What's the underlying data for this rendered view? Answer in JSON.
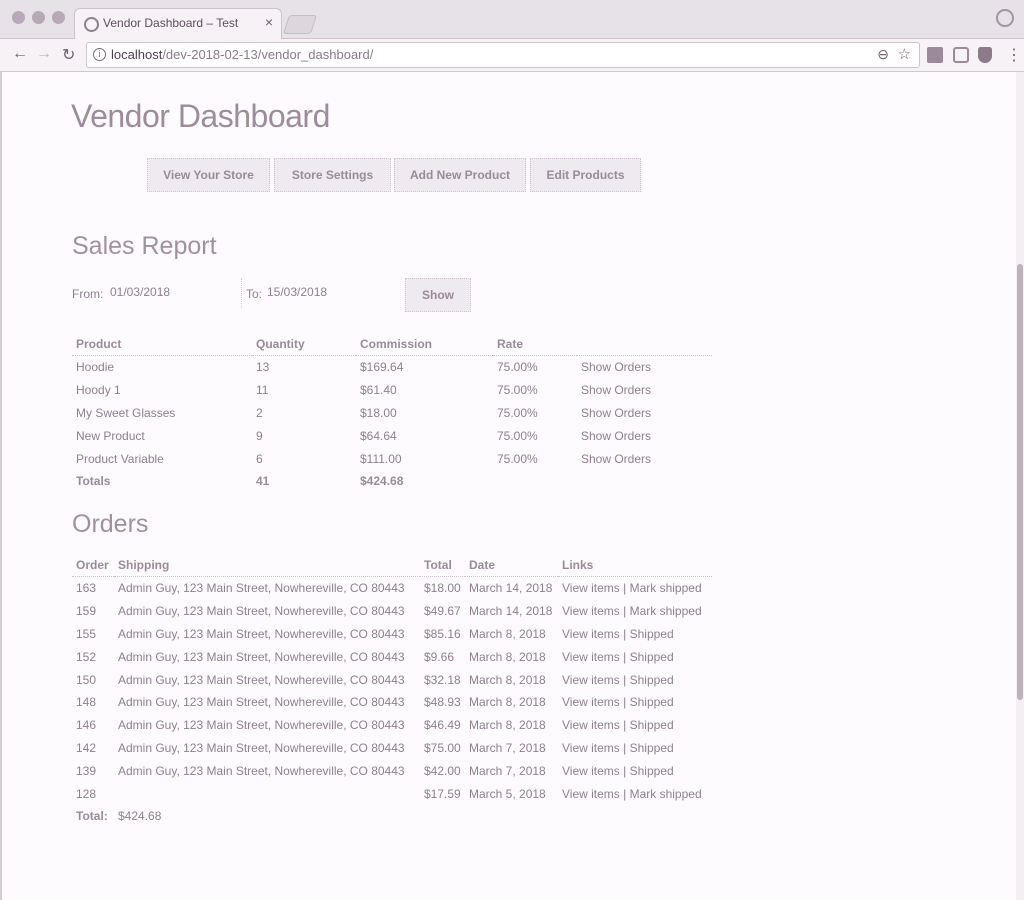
{
  "browser": {
    "tab_title": "Vendor Dashboard – Test",
    "tab_close": "×",
    "url_host": "localhost",
    "url_path": "/dev-2018-02-13/vendor_dashboard/",
    "back_glyph": "←",
    "forward_glyph": "→",
    "reload_glyph": "↻",
    "zoom_glyph": "⊖",
    "star_glyph": "☆",
    "menu_glyph": "⋮"
  },
  "page": {
    "title": "Vendor Dashboard",
    "nav_buttons": [
      "View Your Store",
      "Store Settings",
      "Add New Product",
      "Edit Products"
    ]
  },
  "sales_report": {
    "title": "Sales Report",
    "from_label": "From:",
    "from_value": "01/03/2018",
    "to_label": "To:",
    "to_value": "15/03/2018",
    "show_label": "Show",
    "headers": [
      "Product",
      "Quantity",
      "Commission",
      "Rate"
    ],
    "rows": [
      {
        "product": "Hoodie",
        "quantity": "13",
        "commission": "$169.64",
        "rate": "75.00%",
        "link": "Show Orders"
      },
      {
        "product": "Hoody 1",
        "quantity": "11",
        "commission": "$61.40",
        "rate": "75.00%",
        "link": "Show Orders"
      },
      {
        "product": "My Sweet Glasses",
        "quantity": "2",
        "commission": "$18.00",
        "rate": "75.00%",
        "link": "Show Orders"
      },
      {
        "product": "New Product",
        "quantity": "9",
        "commission": "$64.64",
        "rate": "75.00%",
        "link": "Show Orders"
      },
      {
        "product": "Product Variable",
        "quantity": "6",
        "commission": "$111.00",
        "rate": "75.00%",
        "link": "Show Orders"
      }
    ],
    "totals": {
      "label": "Totals",
      "quantity": "41",
      "commission": "$424.68"
    }
  },
  "orders": {
    "title": "Orders",
    "headers": [
      "Order",
      "Shipping",
      "Total",
      "Date",
      "Links"
    ],
    "rows": [
      {
        "order": "163",
        "shipping": "Admin Guy, 123 Main Street, Nowhereville, CO 80443",
        "total": "$18.00",
        "date": "March 14, 2018",
        "view": "View items",
        "status": "Mark shipped"
      },
      {
        "order": "159",
        "shipping": "Admin Guy, 123 Main Street, Nowhereville, CO 80443",
        "total": "$49.67",
        "date": "March 14, 2018",
        "view": "View items",
        "status": "Mark shipped"
      },
      {
        "order": "155",
        "shipping": "Admin Guy, 123 Main Street, Nowhereville, CO 80443",
        "total": "$85.16",
        "date": "March 8, 2018",
        "view": "View items",
        "status": "Shipped"
      },
      {
        "order": "152",
        "shipping": "Admin Guy, 123 Main Street, Nowhereville, CO 80443",
        "total": "$9.66",
        "date": "March 8, 2018",
        "view": "View items",
        "status": "Shipped"
      },
      {
        "order": "150",
        "shipping": "Admin Guy, 123 Main Street, Nowhereville, CO 80443",
        "total": "$32.18",
        "date": "March 8, 2018",
        "view": "View items",
        "status": "Shipped"
      },
      {
        "order": "148",
        "shipping": "Admin Guy, 123 Main Street, Nowhereville, CO 80443",
        "total": "$48.93",
        "date": "March 8, 2018",
        "view": "View items",
        "status": "Shipped"
      },
      {
        "order": "146",
        "shipping": "Admin Guy, 123 Main Street, Nowhereville, CO 80443",
        "total": "$46.49",
        "date": "March 8, 2018",
        "view": "View items",
        "status": "Shipped"
      },
      {
        "order": "142",
        "shipping": "Admin Guy, 123 Main Street, Nowhereville, CO 80443",
        "total": "$75.00",
        "date": "March 7, 2018",
        "view": "View items",
        "status": "Shipped"
      },
      {
        "order": "139",
        "shipping": "Admin Guy, 123 Main Street, Nowhereville, CO 80443",
        "total": "$42.00",
        "date": "March 7, 2018",
        "view": "View items",
        "status": "Shipped"
      },
      {
        "order": "128",
        "shipping": "",
        "total": "$17.59",
        "date": "March 5, 2018",
        "view": "View items",
        "status": "Mark shipped"
      }
    ],
    "total_label": "Total:",
    "total_value": "$424.68",
    "link_separator": " | "
  }
}
